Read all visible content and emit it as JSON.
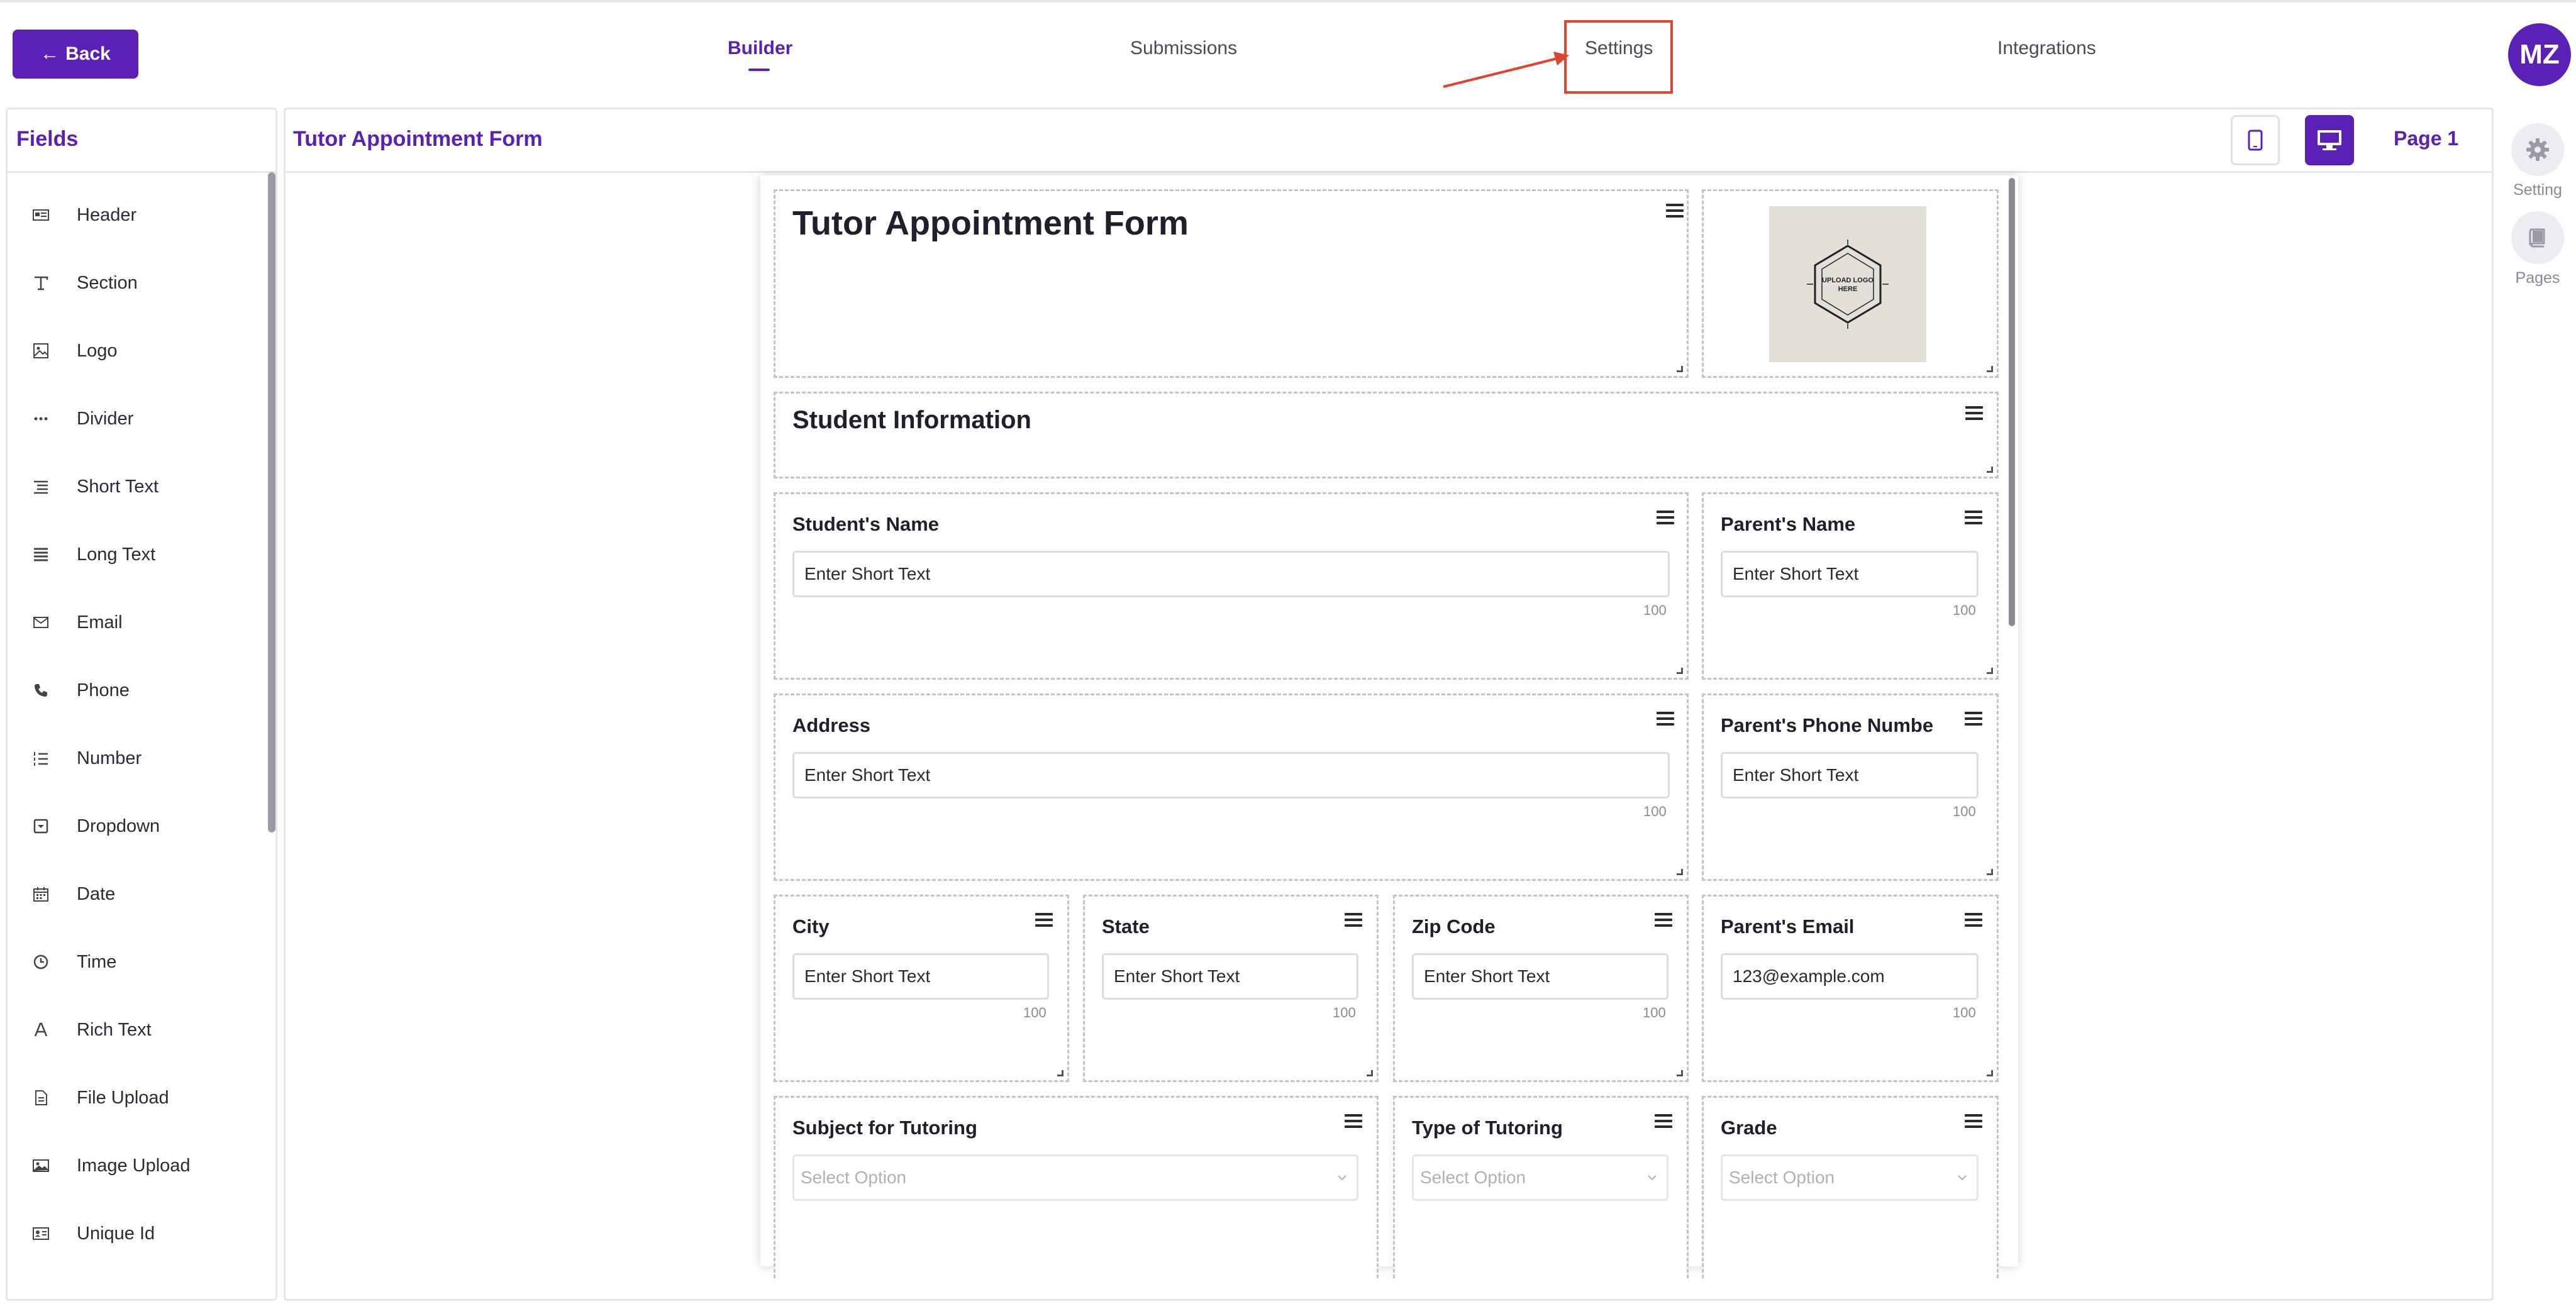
{
  "header": {
    "back_label": "Back",
    "tabs": [
      {
        "label": "Builder",
        "active": true
      },
      {
        "label": "Submissions",
        "active": false
      },
      {
        "label": "Settings",
        "active": false
      },
      {
        "label": "Integrations",
        "active": false
      }
    ],
    "avatar_initials": "MZ"
  },
  "fields_panel": {
    "title": "Fields",
    "items": [
      {
        "label": "Header",
        "icon": "header-icon"
      },
      {
        "label": "Section",
        "icon": "text-t-icon"
      },
      {
        "label": "Logo",
        "icon": "image-icon"
      },
      {
        "label": "Divider",
        "icon": "dots-icon"
      },
      {
        "label": "Short Text",
        "icon": "short-text-icon"
      },
      {
        "label": "Long Text",
        "icon": "long-text-icon"
      },
      {
        "label": "Email",
        "icon": "envelope-icon"
      },
      {
        "label": "Phone",
        "icon": "phone-icon"
      },
      {
        "label": "Number",
        "icon": "numbered-list-icon"
      },
      {
        "label": "Dropdown",
        "icon": "dropdown-icon"
      },
      {
        "label": "Date",
        "icon": "calendar-icon"
      },
      {
        "label": "Time",
        "icon": "clock-icon"
      },
      {
        "label": "Rich Text",
        "icon": "rich-text-icon"
      },
      {
        "label": "File Upload",
        "icon": "file-icon"
      },
      {
        "label": "Image Upload",
        "icon": "image-upload-icon"
      },
      {
        "label": "Unique Id",
        "icon": "id-card-icon"
      }
    ]
  },
  "canvas": {
    "form_name": "Tutor Appointment Form",
    "page_label": "Page 1"
  },
  "form": {
    "title": "Tutor Appointment Form",
    "logo_text": "UPLOAD LOGO HERE",
    "section": "Student Information",
    "fields": {
      "students_name": {
        "label": "Student's Name",
        "value": "Enter Short Text",
        "count": "100"
      },
      "parents_name": {
        "label": "Parent's Name",
        "value": "Enter Short Text",
        "count": "100"
      },
      "address": {
        "label": "Address",
        "value": "Enter Short Text",
        "count": "100"
      },
      "parents_phone": {
        "label": "Parent's Phone Numbe",
        "value": "Enter Short Text",
        "count": "100"
      },
      "city": {
        "label": "City",
        "value": "Enter Short Text",
        "count": "100"
      },
      "state": {
        "label": "State",
        "value": "Enter Short Text",
        "count": "100"
      },
      "zip": {
        "label": "Zip Code",
        "value": "Enter Short Text",
        "count": "100"
      },
      "parents_email": {
        "label": "Parent's Email",
        "value": "123@example.com",
        "count": "100"
      },
      "subject": {
        "label": "Subject for Tutoring",
        "placeholder": "Select Option"
      },
      "type": {
        "label": "Type of Tutoring",
        "placeholder": "Select Option"
      },
      "grade": {
        "label": "Grade",
        "placeholder": "Select Option"
      }
    }
  },
  "right_rail": {
    "setting_label": "Setting",
    "pages_label": "Pages"
  },
  "colors": {
    "accent": "#5b21b6",
    "annotation": "#e0442f"
  }
}
